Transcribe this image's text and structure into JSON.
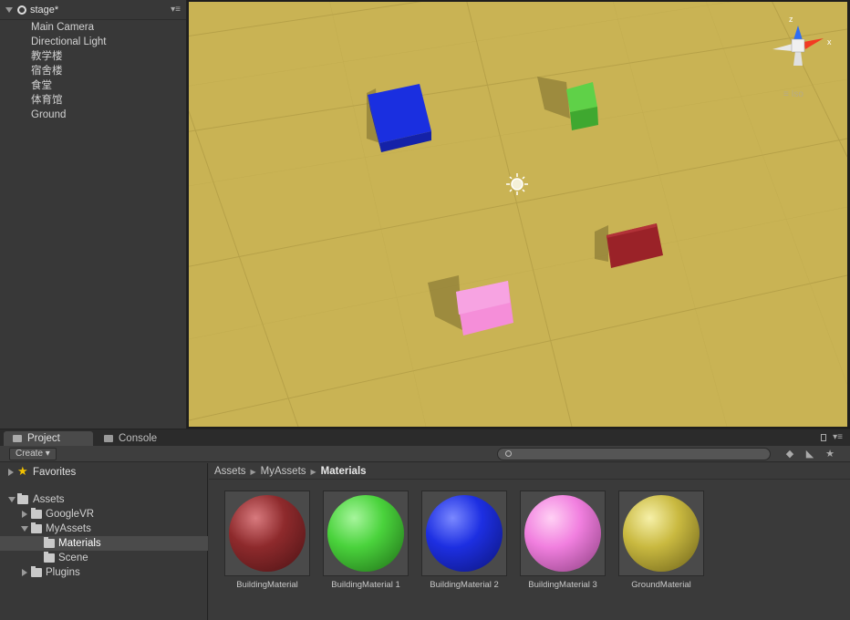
{
  "hierarchy": {
    "scene_name": "stage*",
    "items": [
      "Main Camera",
      "Directional Light",
      "教学楼",
      "宿舍楼",
      "食堂",
      "体育馆",
      "Ground"
    ]
  },
  "scene_view": {
    "gizmo_label": "Iso",
    "gizmo_axes": {
      "x": "x",
      "z": "z"
    },
    "ground_color": "#c9b354",
    "objects": [
      {
        "name": "blue-cube",
        "color": "#1a2fe0"
      },
      {
        "name": "green-cube",
        "color": "#5fd148"
      },
      {
        "name": "red-block",
        "color": "#9a2228"
      },
      {
        "name": "pink-block",
        "color": "#f58ed9"
      }
    ]
  },
  "bottom": {
    "tabs": {
      "project": "Project",
      "console": "Console"
    },
    "create_label": "Create",
    "tree": {
      "favorites": "Favorites",
      "assets": "Assets",
      "googlevr": "GoogleVR",
      "myassets": "MyAssets",
      "materials": "Materials",
      "scene": "Scene",
      "plugins": "Plugins"
    },
    "breadcrumb": {
      "root": "Assets",
      "mid": "MyAssets",
      "current": "Materials"
    },
    "assets": [
      {
        "name": "BuildingMaterial",
        "color": "#8e2a2c"
      },
      {
        "name": "BuildingMaterial 1",
        "color": "#4ad33c"
      },
      {
        "name": "BuildingMaterial 2",
        "color": "#1d2fe2"
      },
      {
        "name": "BuildingMaterial 3",
        "color": "#f17fdf"
      },
      {
        "name": "GroundMaterial",
        "color": "#c9b940"
      }
    ]
  }
}
